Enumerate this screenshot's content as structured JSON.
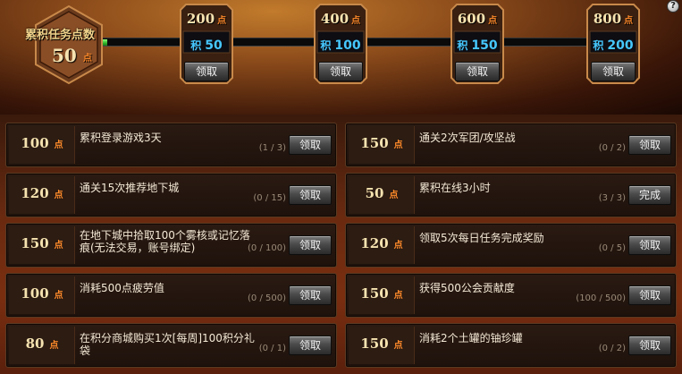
{
  "help_label": "?",
  "summary": {
    "title": "累积任务点数",
    "value": "50",
    "unit": "点"
  },
  "progress": {
    "current": 50,
    "max": 800
  },
  "milestones": [
    {
      "points": "200",
      "unit": "点",
      "reward_prefix": "积",
      "reward": "50",
      "button": "领取"
    },
    {
      "points": "400",
      "unit": "点",
      "reward_prefix": "积",
      "reward": "100",
      "button": "领取"
    },
    {
      "points": "600",
      "unit": "点",
      "reward_prefix": "积",
      "reward": "150",
      "button": "领取"
    },
    {
      "points": "800",
      "unit": "点",
      "reward_prefix": "积",
      "reward": "200",
      "button": "领取"
    }
  ],
  "tasks": [
    {
      "points": "100",
      "unit": "点",
      "desc": "累积登录游戏3天",
      "progress": "(1 / 3)",
      "button": "领取"
    },
    {
      "points": "150",
      "unit": "点",
      "desc": "通关2次军团/攻坚战",
      "progress": "(0 / 2)",
      "button": "领取"
    },
    {
      "points": "120",
      "unit": "点",
      "desc": "通关15次推荐地下城",
      "progress": "(0 / 15)",
      "button": "领取"
    },
    {
      "points": "50",
      "unit": "点",
      "desc": "累积在线3小时",
      "progress": "(3 / 3)",
      "button": "完成"
    },
    {
      "points": "150",
      "unit": "点",
      "desc": "在地下城中拾取100个雾核或记忆落痕(无法交易，账号绑定)",
      "progress": "(0 / 100)",
      "button": "领取"
    },
    {
      "points": "120",
      "unit": "点",
      "desc": "领取5次每日任务完成奖励",
      "progress": "(0 / 5)",
      "button": "领取"
    },
    {
      "points": "100",
      "unit": "点",
      "desc": "消耗500点疲劳值",
      "progress": "(0 / 500)",
      "button": "领取"
    },
    {
      "points": "150",
      "unit": "点",
      "desc": "获得500公会贡献度",
      "progress": "(100 / 500)",
      "button": "领取"
    },
    {
      "points": "80",
      "unit": "点",
      "desc": "在积分商城购买1次[每周]100积分礼袋",
      "progress": "(0 / 1)",
      "button": "领取"
    },
    {
      "points": "150",
      "unit": "点",
      "desc": "消耗2个土罐的铀珍罐",
      "progress": "(0 / 2)",
      "button": "领取"
    }
  ]
}
